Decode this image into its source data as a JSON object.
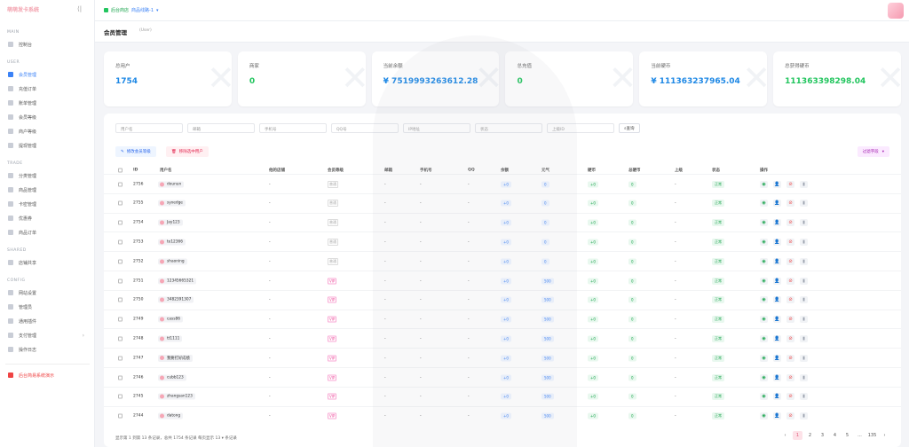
{
  "brand": "萌萌发卡系统",
  "sidebar": {
    "sections": [
      {
        "label": "MAIN",
        "items": [
          {
            "label": "控制台"
          }
        ]
      },
      {
        "label": "USER",
        "items": [
          {
            "label": "会员管理",
            "active": true
          },
          {
            "label": "充值订单"
          },
          {
            "label": "账单管理"
          },
          {
            "label": "会员等级"
          },
          {
            "label": "商户等级"
          },
          {
            "label": "提现管理"
          }
        ]
      },
      {
        "label": "TRADE",
        "items": [
          {
            "label": "分类管理"
          },
          {
            "label": "商品管理"
          },
          {
            "label": "卡密管理"
          },
          {
            "label": "优惠券"
          },
          {
            "label": "商品订单"
          }
        ]
      },
      {
        "label": "SHARED",
        "items": [
          {
            "label": "店铺共享"
          }
        ]
      },
      {
        "label": "CONFIG",
        "items": [
          {
            "label": "网站设置"
          },
          {
            "label": "管理员"
          },
          {
            "label": "通用插件"
          },
          {
            "label": "支付管理"
          },
          {
            "label": "操作日志"
          }
        ]
      }
    ],
    "footer": "后台简易系统演示"
  },
  "topbar": {
    "shop": "后台商店",
    "select": "商品线路-1"
  },
  "header": {
    "title": "会员管理",
    "subtitle": "(User)"
  },
  "stats": [
    {
      "label": "总用户",
      "value": "1754",
      "color": "#1e88e5"
    },
    {
      "label": "商家",
      "value": "0",
      "color": "#22c55e"
    },
    {
      "label": "当前余额",
      "value": "¥ 7519993263612.28",
      "color": "#1e88e5"
    },
    {
      "label": "总充值",
      "value": "0",
      "color": "#22c55e"
    },
    {
      "label": "当前硬币",
      "value": "¥ 111363237965.04",
      "color": "#1e88e5"
    },
    {
      "label": "总获得硬币",
      "value": "111363398298.04",
      "color": "#22c55e"
    }
  ],
  "filters": [
    "用户名",
    "邮箱",
    "手机号",
    "QQ号",
    "IP地址",
    "状态",
    "上级ID"
  ],
  "search_label": "查询",
  "actions": {
    "edit_level": "修改会员等级",
    "delete": "移除选中用户",
    "filter_fields": "过滤字段"
  },
  "columns": [
    "ID",
    "用户名",
    "他的店铺",
    "会员等级",
    "邮箱",
    "手机号",
    "QQ",
    "余额",
    "元气",
    "硬币",
    "总硬币",
    "上级",
    "状态",
    "操作"
  ],
  "rows": [
    {
      "id": "2756",
      "user": "dounun",
      "shop": "-",
      "level": "普通",
      "email": "-",
      "phone": "-",
      "qq": "-",
      "balance": "+0",
      "yuanqi": "0",
      "coin": "+0",
      "total": "0",
      "parent": "-",
      "status": "正常"
    },
    {
      "id": "2755",
      "user": "syxedge",
      "shop": "-",
      "level": "普通",
      "email": "-",
      "phone": "-",
      "qq": "-",
      "balance": "+0",
      "yuanqi": "0",
      "coin": "+0",
      "total": "0",
      "parent": "-",
      "status": "正常"
    },
    {
      "id": "2754",
      "user": "Jay123",
      "shop": "-",
      "level": "普通",
      "email": "-",
      "phone": "-",
      "qq": "-",
      "balance": "+0",
      "yuanqi": "0",
      "coin": "+0",
      "total": "0",
      "parent": "-",
      "status": "正常"
    },
    {
      "id": "2753",
      "user": "te12366",
      "shop": "-",
      "level": "普通",
      "email": "-",
      "phone": "-",
      "qq": "-",
      "balance": "+0",
      "yuanqi": "0",
      "coin": "+0",
      "total": "0",
      "parent": "-",
      "status": "正常"
    },
    {
      "id": "2752",
      "user": "shaoning",
      "shop": "-",
      "level": "普通",
      "email": "-",
      "phone": "-",
      "qq": "-",
      "balance": "+0",
      "yuanqi": "0",
      "coin": "+0",
      "total": "0",
      "parent": "-",
      "status": "正常"
    },
    {
      "id": "2751",
      "user": "12345665321",
      "shop": "-",
      "level": "VIP",
      "email": "-",
      "phone": "-",
      "qq": "-",
      "balance": "+0",
      "yuanqi": "500",
      "coin": "+0",
      "total": "0",
      "parent": "-",
      "status": "正常"
    },
    {
      "id": "2750",
      "user": "3482391307",
      "shop": "-",
      "level": "VIP",
      "email": "-",
      "phone": "-",
      "qq": "-",
      "balance": "+0",
      "yuanqi": "500",
      "coin": "+0",
      "total": "0",
      "parent": "-",
      "status": "正常"
    },
    {
      "id": "2749",
      "user": "cass86",
      "shop": "-",
      "level": "VIP",
      "email": "-",
      "phone": "-",
      "qq": "-",
      "balance": "+0",
      "yuanqi": "500",
      "coin": "+0",
      "total": "0",
      "parent": "-",
      "status": "正常"
    },
    {
      "id": "2748",
      "user": "tt1111",
      "shop": "-",
      "level": "VIP",
      "email": "-",
      "phone": "-",
      "qq": "-",
      "balance": "+0",
      "yuanqi": "500",
      "coin": "+0",
      "total": "0",
      "parent": "-",
      "status": "正常"
    },
    {
      "id": "2747",
      "user": "我要打好成绩",
      "shop": "-",
      "level": "VIP",
      "email": "-",
      "phone": "-",
      "qq": "-",
      "balance": "+0",
      "yuanqi": "500",
      "coin": "+0",
      "total": "0",
      "parent": "-",
      "status": "正常"
    },
    {
      "id": "2746",
      "user": "cubb123",
      "shop": "-",
      "level": "VIP",
      "email": "-",
      "phone": "-",
      "qq": "-",
      "balance": "+0",
      "yuanqi": "500",
      "coin": "+0",
      "total": "0",
      "parent": "-",
      "status": "正常"
    },
    {
      "id": "2745",
      "user": "zhangsan123",
      "shop": "-",
      "level": "VIP",
      "email": "-",
      "phone": "-",
      "qq": "-",
      "balance": "+0",
      "yuanqi": "500",
      "coin": "+0",
      "total": "0",
      "parent": "-",
      "status": "正常"
    },
    {
      "id": "2744",
      "user": "datong",
      "shop": "-",
      "level": "VIP",
      "email": "-",
      "phone": "-",
      "qq": "-",
      "balance": "+0",
      "yuanqi": "500",
      "coin": "+0",
      "total": "0",
      "parent": "-",
      "status": "正常"
    }
  ],
  "pagination": {
    "summary": "显示第 1 到第 13 条记录，总共 1754 条记录 每页显示 13 ▾ 条记录",
    "pages": [
      "‹",
      "1",
      "2",
      "3",
      "4",
      "5",
      "...",
      "135",
      "›"
    ],
    "current": "1"
  }
}
